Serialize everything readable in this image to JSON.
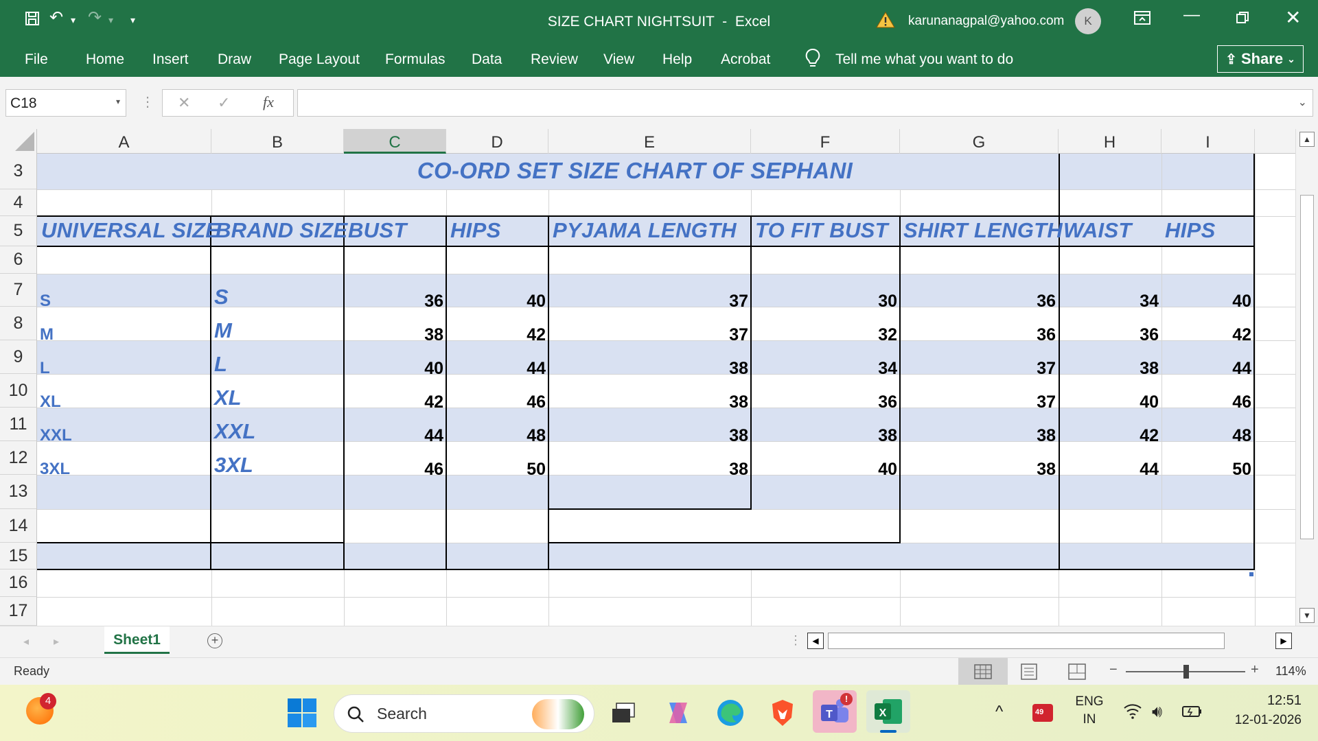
{
  "window": {
    "title": "SIZE CHART NIGHTSUIT  -  Excel",
    "user_email": "karunanagpal@yahoo.com",
    "avatar_initial": "K"
  },
  "ribbon": {
    "tabs": [
      "File",
      "Home",
      "Insert",
      "Draw",
      "Page Layout",
      "Formulas",
      "Data",
      "Review",
      "View",
      "Help",
      "Acrobat"
    ],
    "tell_me": "Tell me what you want to do",
    "share_label": "Share"
  },
  "formula_bar": {
    "name_box": "C18",
    "fx": "fx",
    "value": ""
  },
  "columns": [
    "A",
    "B",
    "C",
    "D",
    "E",
    "F",
    "G",
    "H",
    "I"
  ],
  "rows": [
    "3",
    "4",
    "5",
    "6",
    "7",
    "8",
    "9",
    "10",
    "11",
    "12",
    "13",
    "14",
    "15",
    "16",
    "17"
  ],
  "sheet": {
    "title": "CO-ORD SET SIZE CHART OF SEPHANI",
    "headers": [
      "UNIVERSAL SIZE",
      "BRAND SIZE",
      "BUST",
      "HIPS",
      "PYJAMA LENGTH",
      "TO FIT BUST",
      "SHIRT LENGTH",
      "WAIST",
      "HIPS"
    ],
    "data": [
      [
        "S",
        "S",
        "36",
        "40",
        "37",
        "30",
        "36",
        "34",
        "40"
      ],
      [
        "M",
        "M",
        "38",
        "42",
        "37",
        "32",
        "36",
        "36",
        "42"
      ],
      [
        "L",
        "L",
        "40",
        "44",
        "38",
        "34",
        "37",
        "38",
        "44"
      ],
      [
        "XL",
        "XL",
        "42",
        "46",
        "38",
        "36",
        "37",
        "40",
        "46"
      ],
      [
        "XXL",
        "XXL",
        "44",
        "48",
        "38",
        "38",
        "38",
        "42",
        "48"
      ],
      [
        "3XL",
        "3XL",
        "46",
        "50",
        "38",
        "40",
        "38",
        "44",
        "50"
      ]
    ]
  },
  "sheet_tabs": {
    "active": "Sheet1"
  },
  "status": {
    "ready": "Ready",
    "zoom": "114%"
  },
  "taskbar": {
    "search_placeholder": "Search",
    "notification_count": "4",
    "language": "ENG",
    "region": "IN",
    "time": "12:51",
    "date": "12-01-2026",
    "battery_badge": "49"
  }
}
